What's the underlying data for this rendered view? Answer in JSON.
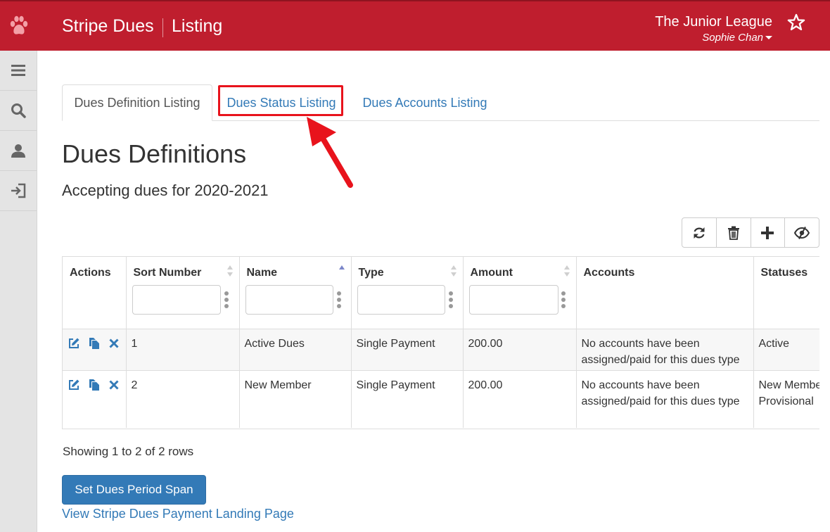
{
  "header": {
    "app_title": "Stripe Dues",
    "page_label": "Listing",
    "org_name": "The Junior League",
    "user_name": "Sophie Chan",
    "brand_color": "#bf1e2e"
  },
  "sidebar": {
    "items": [
      {
        "icon": "hamburger-menu-icon"
      },
      {
        "icon": "search-icon"
      },
      {
        "icon": "user-icon"
      },
      {
        "icon": "sign-out-icon"
      }
    ]
  },
  "tabs": [
    {
      "label": "Dues Definition Listing",
      "active": true
    },
    {
      "label": "Dues Status Listing",
      "active": false,
      "highlighted": true
    },
    {
      "label": "Dues Accounts Listing",
      "active": false
    }
  ],
  "main": {
    "heading": "Dues Definitions",
    "subtitle": "Accepting dues for 2020-2021"
  },
  "toolbar": {
    "buttons": [
      "refresh-icon",
      "trash-icon",
      "plus-icon",
      "column-visibility-icon"
    ]
  },
  "table": {
    "columns": [
      "Actions",
      "Sort Number",
      "Name",
      "Type",
      "Amount",
      "Accounts",
      "Statuses"
    ],
    "rows": [
      {
        "sort": "1",
        "name": "Active Dues",
        "type": "Single Payment",
        "amount": "200.00",
        "accounts": "No accounts have been assigned/paid for this dues type",
        "statuses": "Active"
      },
      {
        "sort": "2",
        "name": "New Member",
        "type": "Single Payment",
        "amount": "200.00",
        "accounts": "No accounts have been assigned/paid for this dues type",
        "statuses": "New Member Provisional"
      }
    ]
  },
  "footer": {
    "showing": "Showing 1 to 2 of 2 rows",
    "primary_button": "Set Dues Period Span",
    "landing_link": "View Stripe Dues Payment Landing Page"
  }
}
